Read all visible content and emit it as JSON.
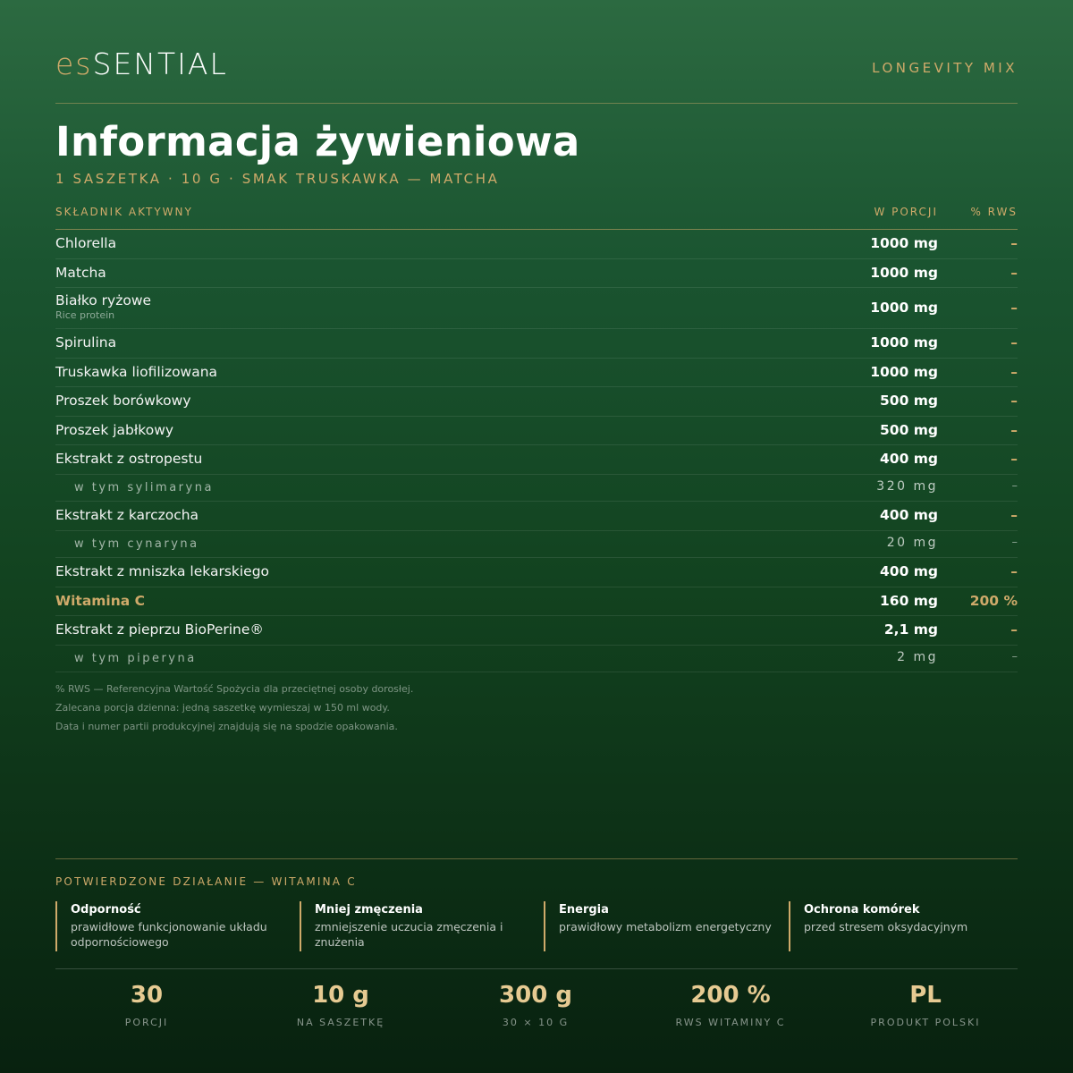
{
  "brand": {
    "prefix": "es",
    "main": "SENTIAL"
  },
  "product": "LONGEVITY MIX",
  "title": "Informacja żywieniowa",
  "subtitle": "1 SASZETKA · 10 G · SMAK TRUSKAWKA — MATCHA",
  "table": {
    "headers": {
      "ingredient": "SKŁADNIK AKTYWNY",
      "per_serving": "W PORCJI",
      "rws": "% RWS"
    },
    "rows": [
      {
        "name": "Chlorella",
        "amount": "1000 mg",
        "rws": "–",
        "kind": "main"
      },
      {
        "name": "Matcha",
        "amount": "1000 mg",
        "rws": "–",
        "kind": "main"
      },
      {
        "name": "Białko ryżowe",
        "sub": "Rice protein",
        "amount": "1000 mg",
        "rws": "–",
        "kind": "tall"
      },
      {
        "name": "Spirulina",
        "amount": "1000 mg",
        "rws": "–",
        "kind": "main"
      },
      {
        "name": "Truskawka liofilizowana",
        "amount": "1000 mg",
        "rws": "–",
        "kind": "main"
      },
      {
        "name": "Proszek borówkowy",
        "amount": "500 mg",
        "rws": "–",
        "kind": "main"
      },
      {
        "name": "Proszek jabłkowy",
        "amount": "500 mg",
        "rws": "–",
        "kind": "main"
      },
      {
        "name": "Ekstrakt z ostropestu",
        "amount": "400 mg",
        "rws": "–",
        "kind": "main"
      },
      {
        "name": "w tym sylimaryna",
        "amount": "320 mg",
        "rws": "–",
        "kind": "nested"
      },
      {
        "name": "Ekstrakt z karczocha",
        "amount": "400 mg",
        "rws": "–",
        "kind": "main"
      },
      {
        "name": "w tym cynaryna",
        "amount": "20 mg",
        "rws": "–",
        "kind": "nested"
      },
      {
        "name": "Ekstrakt z mniszka lekarskiego",
        "amount": "400 mg",
        "rws": "–",
        "kind": "main"
      },
      {
        "name": "Witamina C",
        "amount": "160 mg",
        "rws": "200 %",
        "kind": "highlight"
      },
      {
        "name": "Ekstrakt z pieprzu BioPerine®",
        "amount": "2,1 mg",
        "rws": "–",
        "kind": "main"
      },
      {
        "name": "w tym piperyna",
        "amount": "2 mg",
        "rws": "–",
        "kind": "nested"
      }
    ]
  },
  "notes": [
    "% RWS — Referencyjna Wartość Spożycia dla przeciętnej osoby dorosłej.",
    "Zalecana porcja dzienna: jedną saszetkę wymieszaj w 150 ml wody.",
    "Data i numer partii produkcyjnej znajdują się na spodzie opakowania."
  ],
  "claims": {
    "title": "POTWIERDZONE DZIAŁANIE — WITAMINA C",
    "items": [
      {
        "title": "Odporność",
        "desc": "prawidłowe funkcjonowanie układu odpornościowego"
      },
      {
        "title": "Mniej zmęczenia",
        "desc": "zmniejszenie uczucia zmęczenia i znużenia"
      },
      {
        "title": "Energia",
        "desc": "prawidłowy metabolizm energetyczny"
      },
      {
        "title": "Ochrona komórek",
        "desc": "przed stresem oksydacyjnym"
      }
    ]
  },
  "stats": [
    {
      "value": "30",
      "label": "PORCJI"
    },
    {
      "value": "10 g",
      "label": "NA SASZETKĘ"
    },
    {
      "value": "300 g",
      "label": "30 × 10 G"
    },
    {
      "value": "200 %",
      "label": "RWS WITAMINY C"
    },
    {
      "value": "PL",
      "label": "PRODUKT POLSKI"
    }
  ],
  "colors": {
    "accent": "#cfaa6a",
    "background_top": "#2c6a41",
    "background_bottom": "#08210f"
  }
}
